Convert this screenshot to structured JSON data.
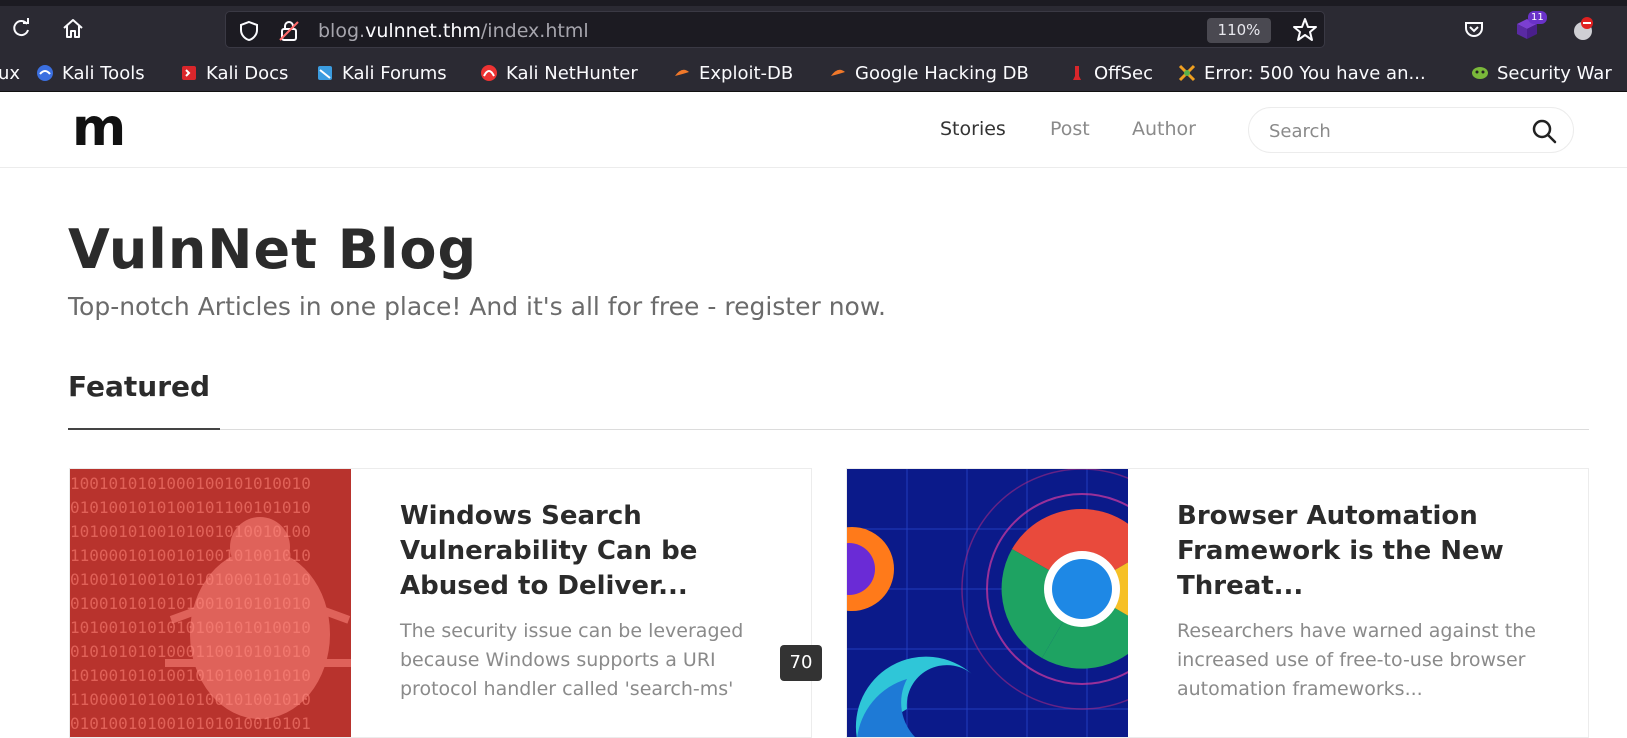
{
  "browser": {
    "url_prefix": "blog.",
    "url_host": "vulnnet.thm",
    "url_path": "/index.html",
    "zoom": "110%",
    "extension_badge": "11",
    "bookmarks": [
      {
        "label": "ux",
        "icon": "kali-icon"
      },
      {
        "label": "Kali Tools",
        "icon": "kali-tools-icon"
      },
      {
        "label": "Kali Docs",
        "icon": "kali-docs-icon"
      },
      {
        "label": "Kali Forums",
        "icon": "kali-forums-icon"
      },
      {
        "label": "Kali NetHunter",
        "icon": "nethunter-icon"
      },
      {
        "label": "Exploit-DB",
        "icon": "exploit-db-icon"
      },
      {
        "label": "Google Hacking DB",
        "icon": "ghdb-icon"
      },
      {
        "label": "OffSec",
        "icon": "offsec-icon"
      },
      {
        "label": "Error: 500 You have an...",
        "icon": "error-page-icon"
      },
      {
        "label": "Security War",
        "icon": "security-war-icon"
      }
    ]
  },
  "site": {
    "logo": "m",
    "nav": [
      {
        "label": "Stories",
        "active": true
      },
      {
        "label": "Post",
        "active": false
      },
      {
        "label": "Author",
        "active": false
      }
    ],
    "search_placeholder": "Search"
  },
  "hero": {
    "title": "VulnNet Blog",
    "subtitle": "Top-notch Articles in one place! And it's all for free - register now."
  },
  "featured": {
    "heading": "Featured",
    "cards": [
      {
        "title": "Windows Search Vulnerability Can be Abused to Deliver...",
        "excerpt": "The security issue can be leveraged because Windows supports a URI protocol handler called 'search-ms'"
      },
      {
        "title": "Browser Automation Framework is the New Threat...",
        "excerpt": "Researchers have warned against the increased use of free-to-use browser automation frameworks..."
      }
    ]
  },
  "overlay_badge": "70",
  "colors": {
    "chrome_bg": "#2b2a33",
    "urlbar_bg": "#1c1b22",
    "text_dark": "#2b2b2b",
    "text_muted": "#8a8a8a"
  }
}
